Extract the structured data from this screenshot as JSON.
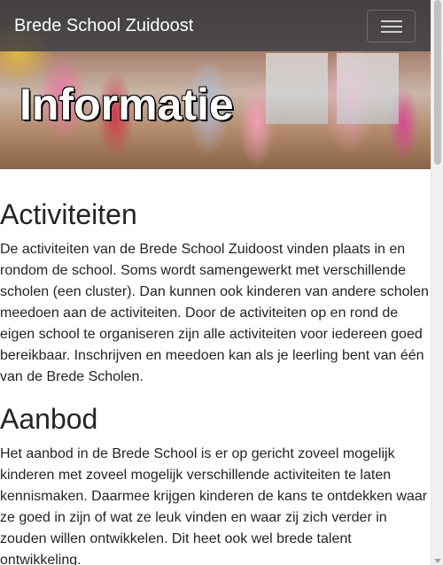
{
  "navbar": {
    "brand": "Brede School Zuidoost",
    "toggler_icon": "hamburger-menu-icon"
  },
  "hero": {
    "title": "Informatie"
  },
  "sections": [
    {
      "heading": "Activiteiten",
      "text": "De activiteiten van de Brede School Zuidoost vinden plaats in en rondom de school. Soms wordt samengewerkt met verschillende scholen (een cluster). Dan kunnen ook kinderen van andere scholen meedoen aan de activiteiten. Door de activiteiten op en rond de eigen school te organiseren zijn alle activiteiten voor iedereen goed bereikbaar. Inschrijven en meedoen kan als je leerling bent van één van de Brede Scholen."
    },
    {
      "heading": "Aanbod",
      "text": "Het aanbod in de Brede School is er op gericht zoveel mogelijk kinderen met zoveel mogelijk verschillende activiteiten te laten kennismaken. Daarmee krijgen kinderen de kans te ontdekken waar ze goed in zijn of wat ze leuk vinden en waar zij zich verder in zouden willen ontwikkelen. Dit heet ook wel brede talent ontwikkeling."
    }
  ]
}
